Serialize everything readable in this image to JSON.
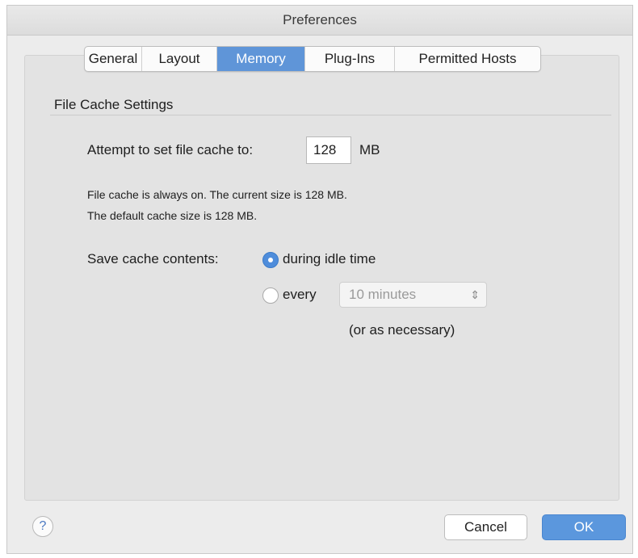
{
  "window": {
    "title": "Preferences"
  },
  "tabs": [
    {
      "label": "General"
    },
    {
      "label": "Layout"
    },
    {
      "label": "Memory"
    },
    {
      "label": "Plug-Ins"
    },
    {
      "label": "Permitted Hosts"
    }
  ],
  "active_tab": "Memory",
  "file_cache": {
    "section_title": "File Cache Settings",
    "attempt_label": "Attempt to set file cache to:",
    "cache_value": "128",
    "unit": "MB",
    "info_line1": "File cache is always on. The current size is 128 MB.",
    "info_line2": "The default cache size is 128 MB."
  },
  "save_cache": {
    "label": "Save cache contents:",
    "option_idle": "during idle time",
    "option_every": "every",
    "selected": "during idle time",
    "interval_value": "10 minutes",
    "note": "(or as necessary)"
  },
  "footer": {
    "help_label": "?",
    "cancel_label": "Cancel",
    "ok_label": "OK"
  },
  "colors": {
    "accent": "#5f95d8",
    "ok_button": "#5b97dd",
    "panel": "#e3e3e3"
  },
  "icons": {
    "help": "question-mark-icon",
    "select": "chevron-up-down-icon"
  }
}
